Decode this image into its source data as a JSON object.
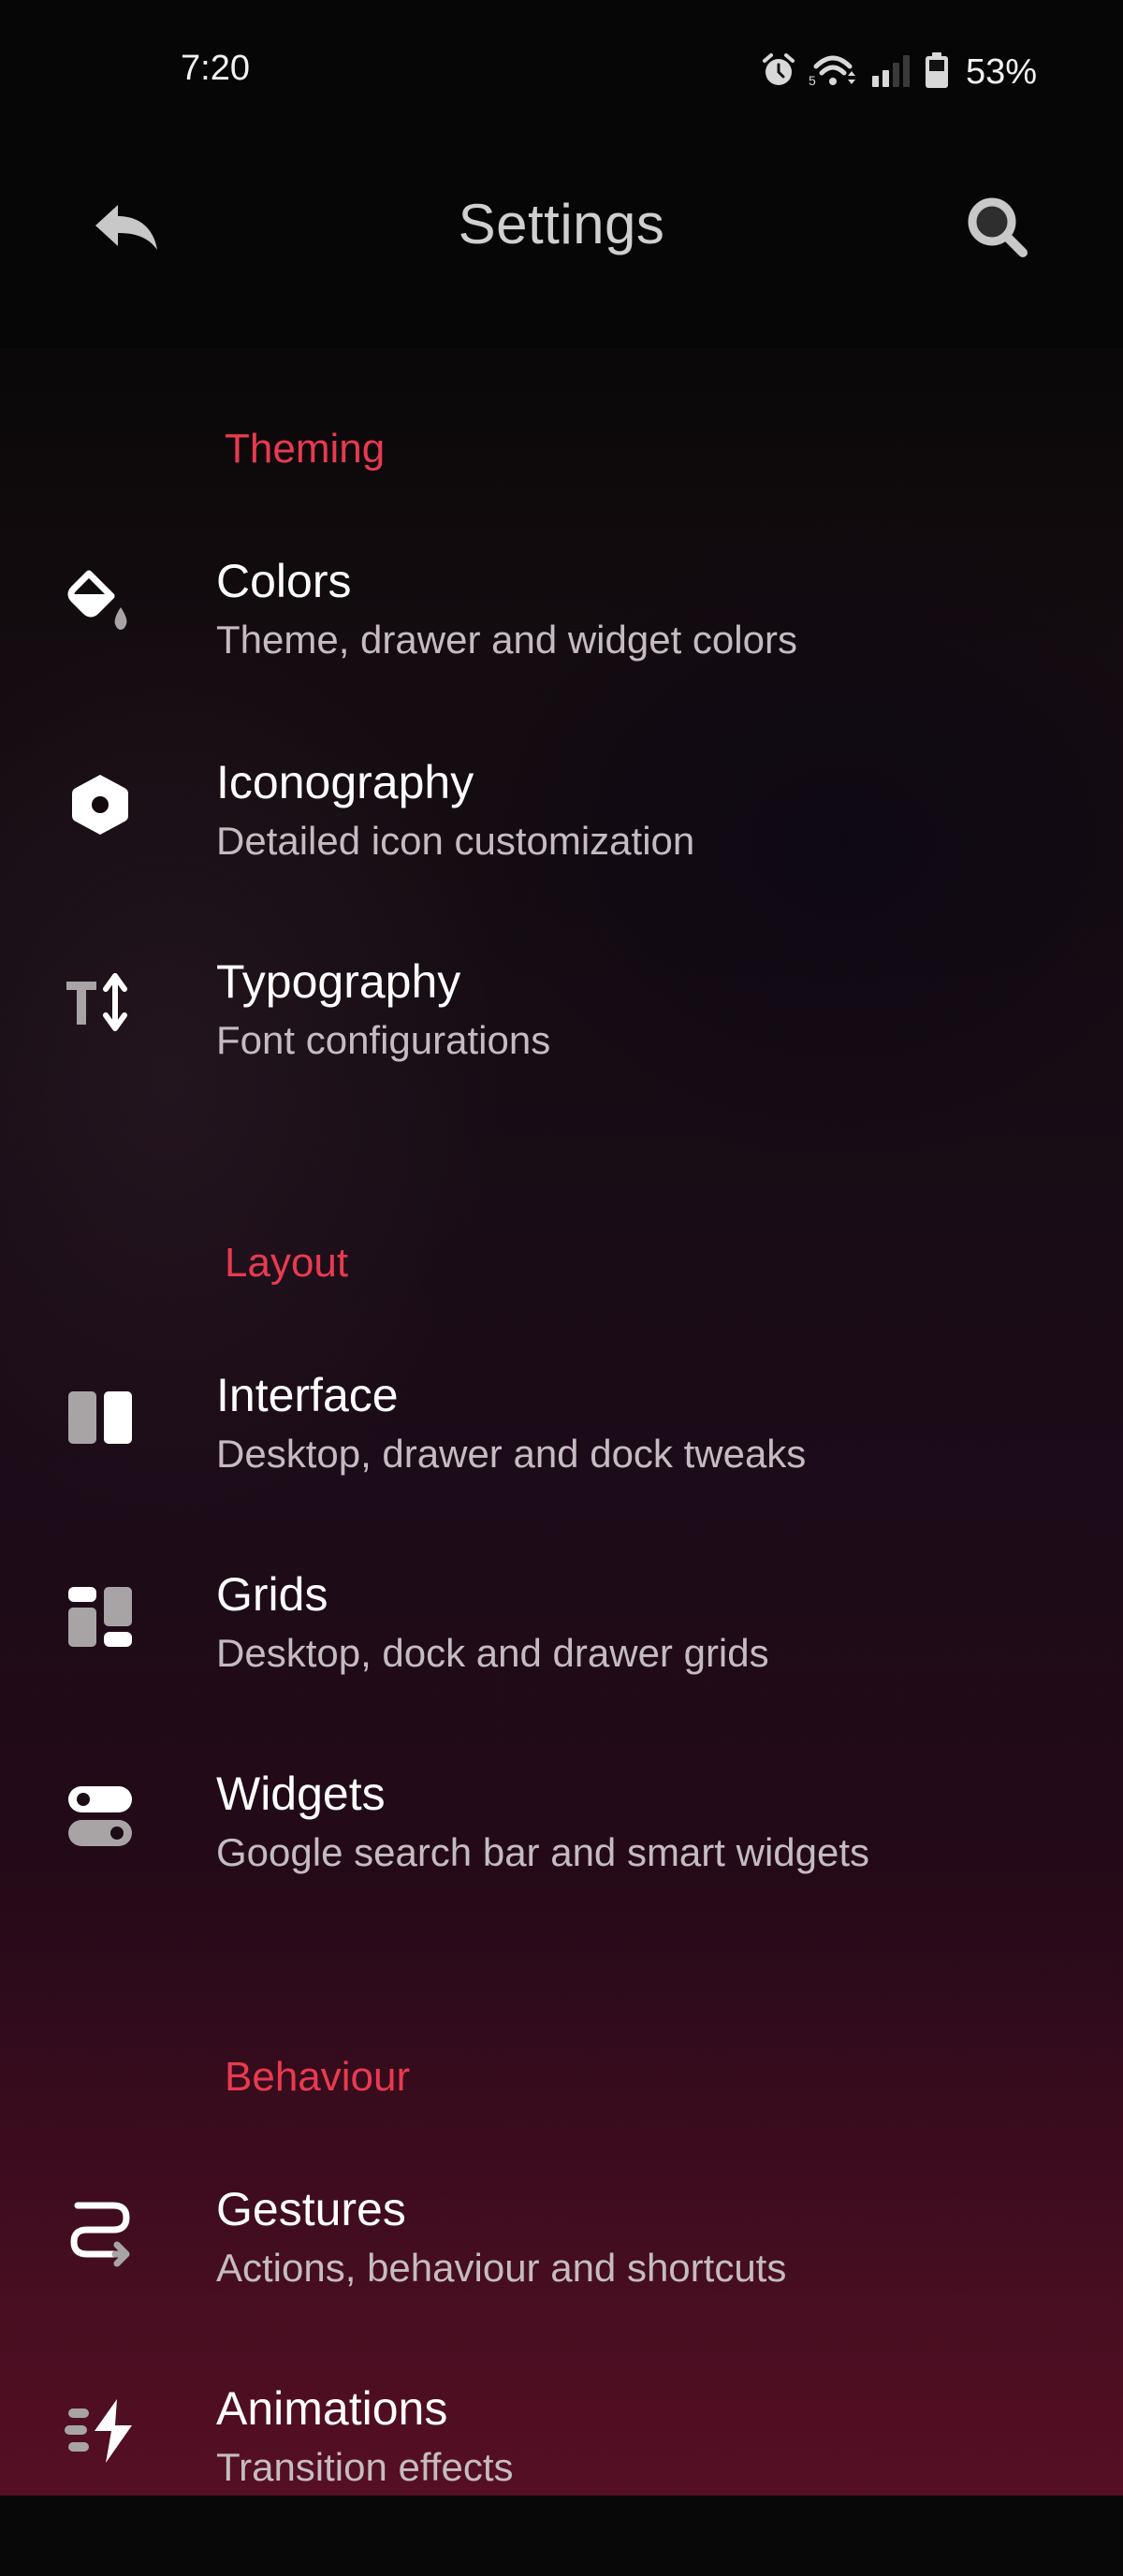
{
  "status_bar": {
    "time": "7:20",
    "icons": [
      "alarm-icon",
      "wifi-5g-icon",
      "cell-signal-icon",
      "battery-icon"
    ],
    "battery_percent": "53%"
  },
  "toolbar": {
    "title": "Settings",
    "back_icon": "back-arrow-icon",
    "search_icon": "search-icon"
  },
  "accent_color": "#e83a50",
  "sections": [
    {
      "header": "Theming",
      "items": [
        {
          "title": "Colors",
          "subtitle": "Theme, drawer and widget colors",
          "icon": "paint-bucket-icon"
        },
        {
          "title": "Iconography",
          "subtitle": "Detailed icon customization",
          "icon": "hexagon-nut-icon"
        },
        {
          "title": "Typography",
          "subtitle": "Font configurations",
          "icon": "text-size-icon"
        }
      ]
    },
    {
      "header": "Layout",
      "items": [
        {
          "title": "Interface",
          "subtitle": "Desktop, drawer and dock tweaks",
          "icon": "columns-icon"
        },
        {
          "title": "Grids",
          "subtitle": "Desktop, dock and drawer grids",
          "icon": "grid-icon"
        },
        {
          "title": "Widgets",
          "subtitle": "Google search bar and smart widgets",
          "icon": "toggles-icon"
        }
      ]
    },
    {
      "header": "Behaviour",
      "items": [
        {
          "title": "Gestures",
          "subtitle": "Actions, behaviour and shortcuts",
          "icon": "gesture-path-icon"
        },
        {
          "title": "Animations",
          "subtitle": "Transition effects",
          "icon": "fast-bolt-icon"
        }
      ]
    }
  ]
}
